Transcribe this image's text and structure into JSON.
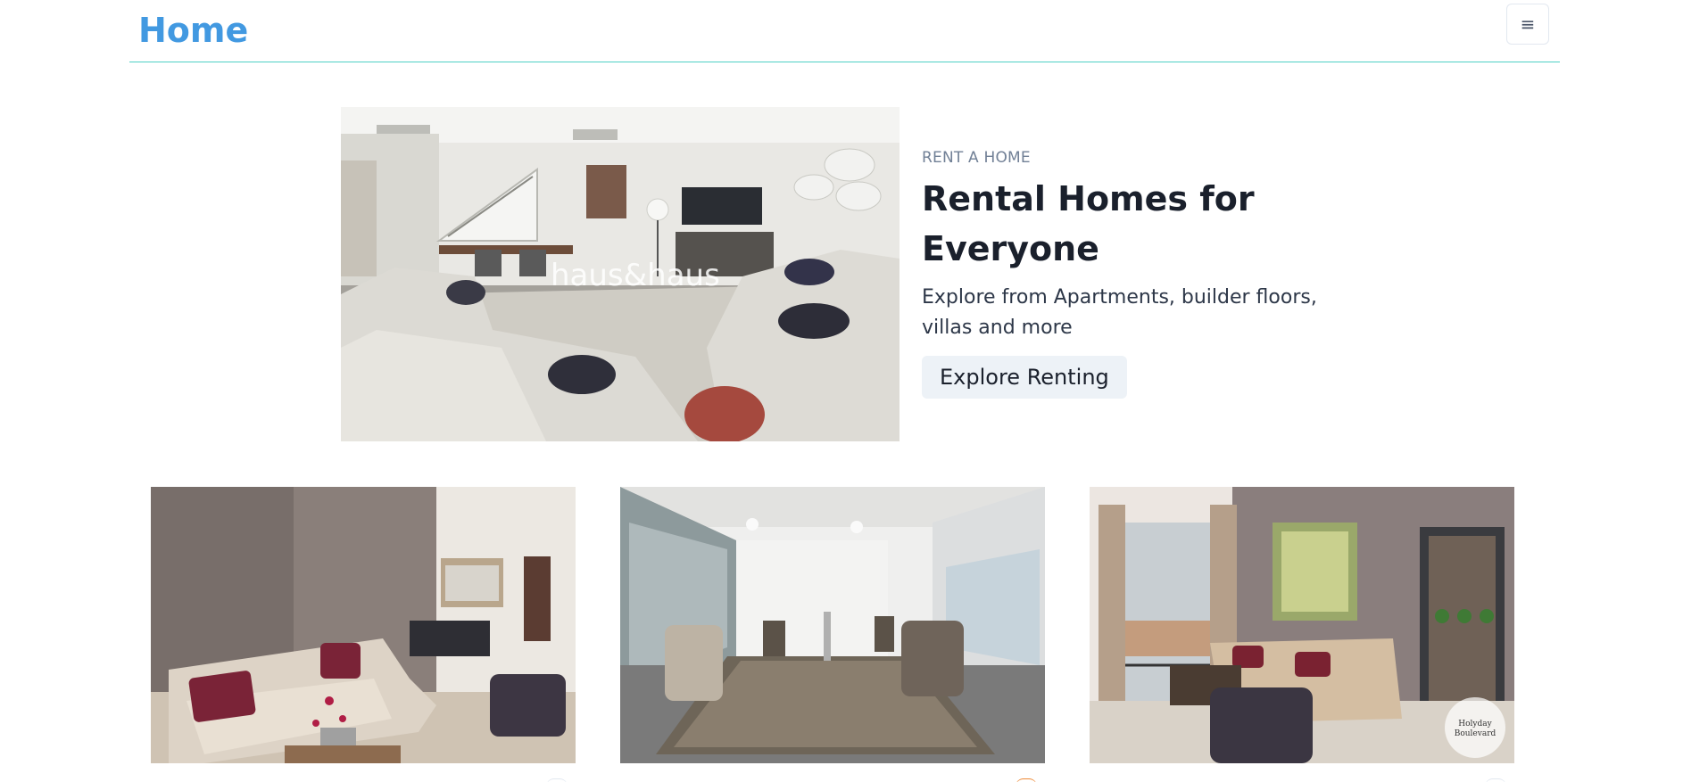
{
  "header": {
    "brand": "Home",
    "menu_icon": "hamburger-icon",
    "menu_glyph": "≡"
  },
  "hero": {
    "eyebrow": "RENT A HOME",
    "title": "Rental Homes for Everyone",
    "subtitle": "Explore from Apartments, builder floors, villas and more",
    "cta_label": "Explore Renting",
    "image_watermark": "haus&haus"
  },
  "listings": [
    {
      "image_alt": "living room with beige sofa"
    },
    {
      "image_alt": "office meeting room"
    },
    {
      "image_alt": "living room with balcony",
      "watermark": "Holyday Boulevard"
    }
  ],
  "colors": {
    "brand": "#4299e1",
    "divider": "#4fd1c5",
    "button_bg": "#edf2f7"
  }
}
